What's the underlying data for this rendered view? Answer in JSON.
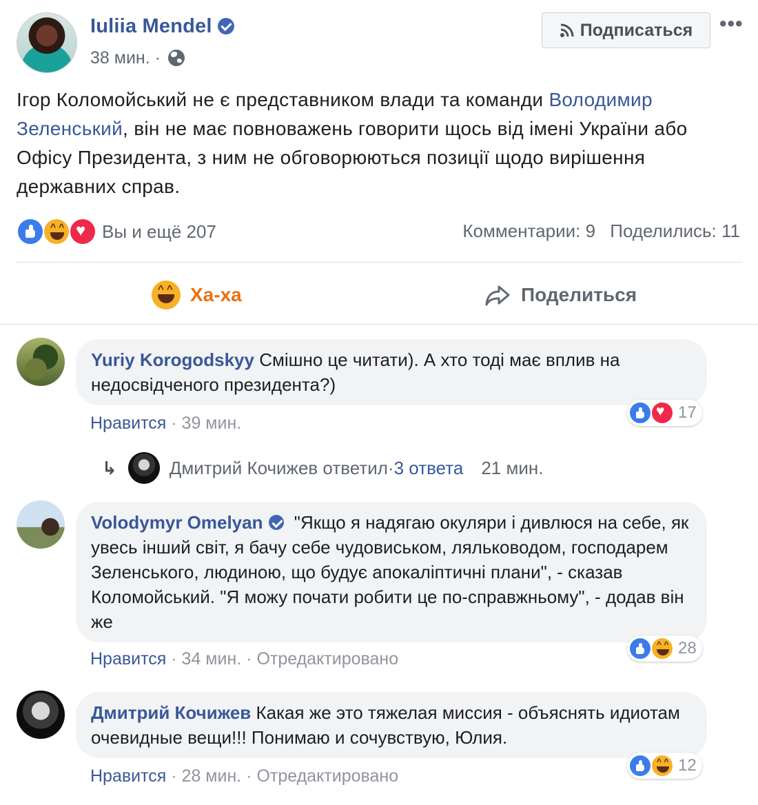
{
  "post": {
    "author": "Iuliia Mendel",
    "time": "38 мин.",
    "subscribe_label": "Подписаться",
    "more_label": "•••",
    "text_before": "Ігор Коломойський не є представником влади та команди ",
    "mention": "Володимир Зеленський",
    "text_after": ", він не має повноважень говорити щось від імені України або Офісу Президента, з ним не обговорюються позиції щодо вирішення державних справ.",
    "reactions_text": "Вы и ещё 207",
    "comments_count": "Комментарии: 9",
    "shares_count": "Поделились: 11",
    "action_haha": "Ха-ха",
    "action_share": "Поделиться"
  },
  "comments": [
    {
      "author": "Yuriy Korogodskyy",
      "text": "Смішно це читати). А хто тоді має вплив на недосвідченого президента?)",
      "like_label": "Нравится",
      "time": "39 мин.",
      "reaction_count": "17"
    },
    {
      "author": "Volodymyr Omelyan",
      "text": "\"Якщо я надягаю окуляри і дивлюся на себе, як увесь інший світ, я бачу себе чудовиськом, ляльководом, господарем Зеленського, людиною, що будує апокаліптичні плани\", - сказав Коломойський. \"Я можу почати робити це по-справжньому\", - додав він же",
      "like_label": "Нравится",
      "time": "34 мин.",
      "edited": "Отредактировано",
      "reaction_count": "28"
    },
    {
      "author": "Дмитрий Кочижев",
      "text": "Какая же это тяжелая миссия - объяснять идиотам очевидные вещи!!! Понимаю и сочувствую, Юлия.",
      "like_label": "Нравится",
      "time": "28 мин.",
      "edited": "Отредактировано",
      "reaction_count": "12"
    }
  ],
  "reply": {
    "arrow": "↳",
    "author": "Дмитрий Кочижев ответил",
    "sep": " · ",
    "count": "3 ответа",
    "time": "21 мин."
  }
}
